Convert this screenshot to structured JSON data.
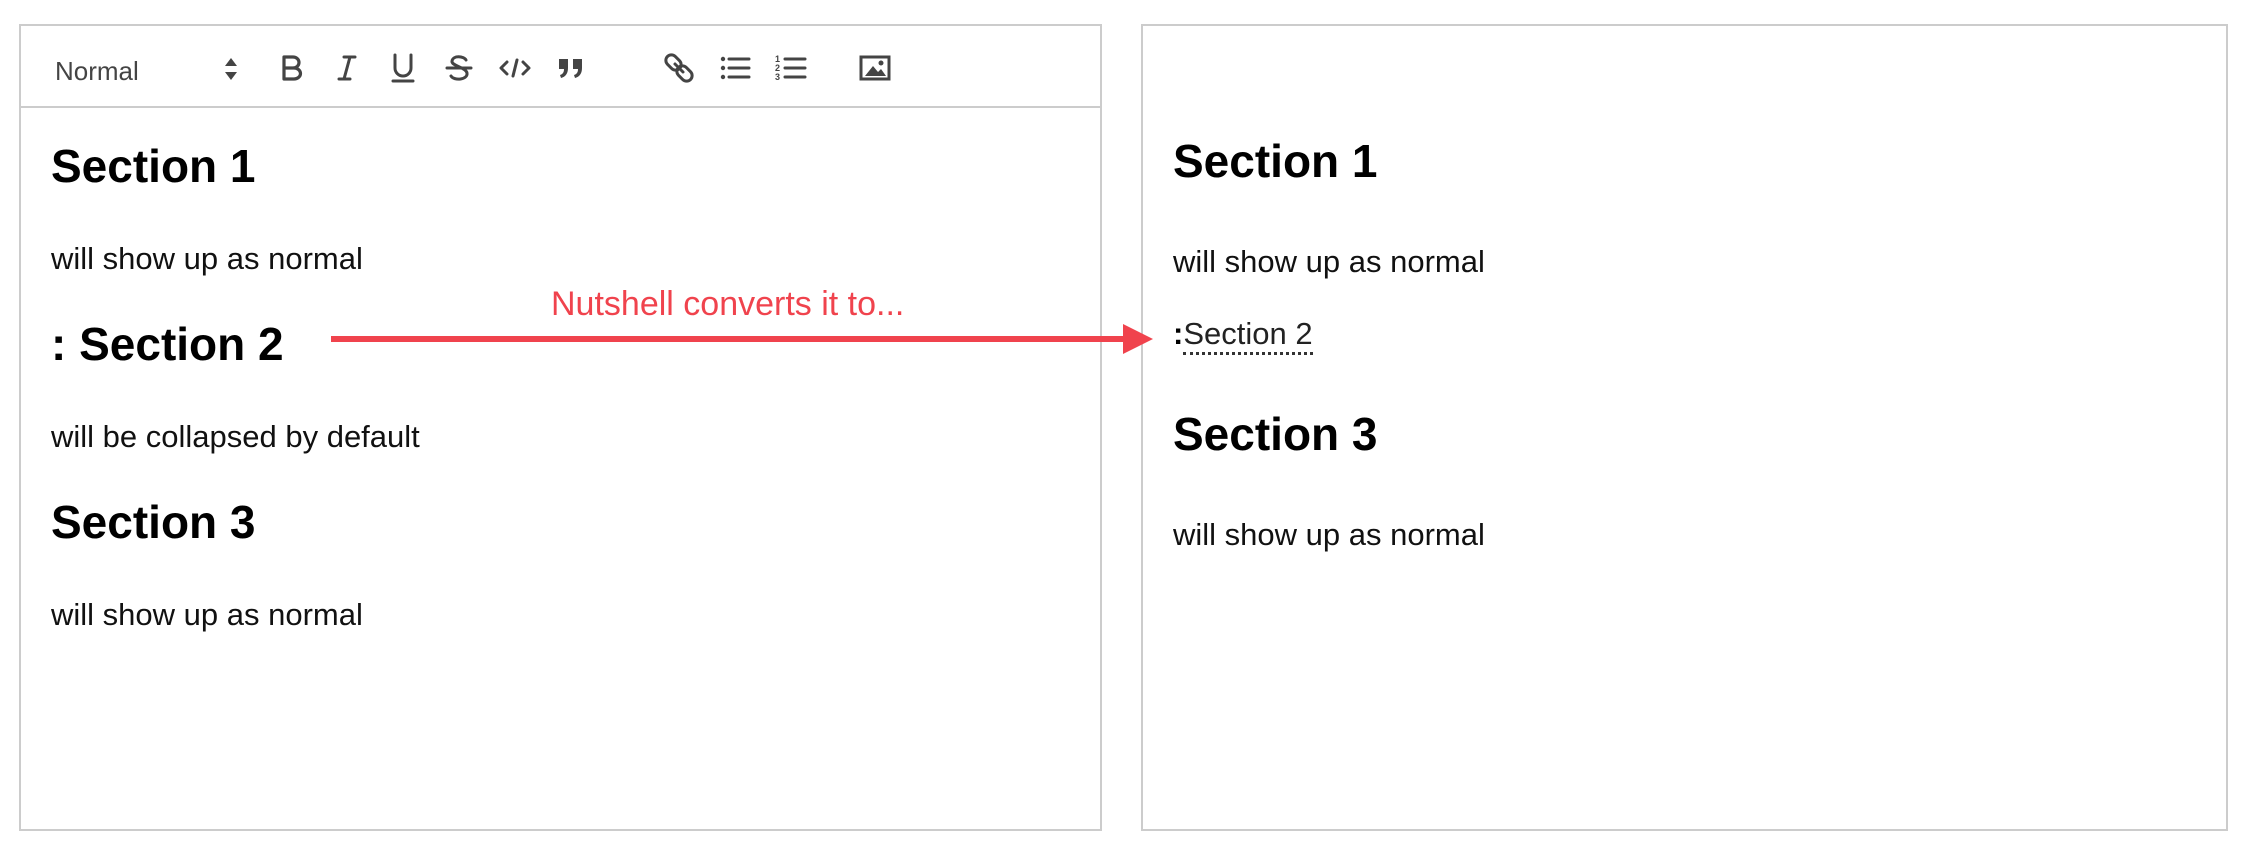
{
  "colors": {
    "border": "#cccccc",
    "arrow": "#f0434d",
    "annotation": "#f0434d",
    "icon": "#444444"
  },
  "editor": {
    "toolbar": {
      "format_select": "Normal",
      "buttons": [
        {
          "icon": "bold-icon"
        },
        {
          "icon": "italic-icon"
        },
        {
          "icon": "underline-icon"
        },
        {
          "icon": "strike-icon"
        },
        {
          "icon": "code-icon"
        },
        {
          "icon": "blockquote-icon"
        },
        {
          "icon": "link-icon"
        },
        {
          "icon": "bullet-list-icon"
        },
        {
          "icon": "ordered-list-icon"
        },
        {
          "icon": "image-icon"
        }
      ]
    },
    "blocks": [
      {
        "type": "heading",
        "text": "Section 1"
      },
      {
        "type": "paragraph",
        "text": "will show up as normal"
      },
      {
        "type": "heading",
        "text": ": Section 2"
      },
      {
        "type": "paragraph",
        "text": "will be collapsed by default"
      },
      {
        "type": "heading",
        "text": "Section 3"
      },
      {
        "type": "paragraph",
        "text": "will show up as normal"
      }
    ]
  },
  "annotation": {
    "text": "Nutshell converts it to..."
  },
  "preview": {
    "section1_heading": "Section 1",
    "section1_text": "will show up as normal",
    "collapsed_colon": ":",
    "collapsed_label": "Section 2",
    "section3_heading": "Section 3",
    "section3_text": "will show up as normal"
  }
}
